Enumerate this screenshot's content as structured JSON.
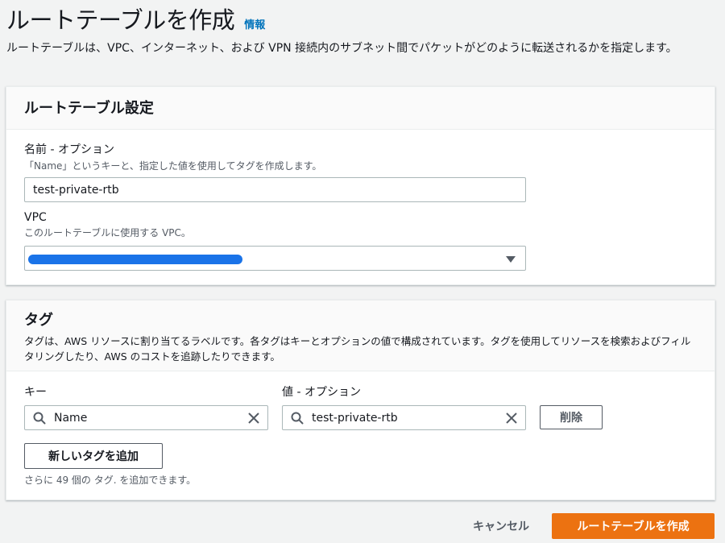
{
  "header": {
    "title": "ルートテーブルを作成",
    "info_link": "情報",
    "description": "ルートテーブルは、VPC、インターネット、および VPN 接続内のサブネット間でパケットがどのように転送されるかを指定します。"
  },
  "settings": {
    "title": "ルートテーブル設定",
    "name": {
      "label": "名前 - オプション",
      "description": "「Name」というキーと、指定した値を使用してタグを作成します。",
      "value": "test-private-rtb"
    },
    "vpc": {
      "label": "VPC",
      "description": "このルートテーブルに使用する VPC。"
    }
  },
  "tags": {
    "title": "タグ",
    "description": "タグは、AWS リソースに割り当てるラベルです。各タグはキーとオプションの値で構成されています。タグを使用してリソースを検索およびフィルタリングしたり、AWS のコストを追跡したりできます。",
    "key_label": "キー",
    "value_label": "値 - オプション",
    "key_value": "Name",
    "value_value": "test-private-rtb",
    "remove_button": "削除",
    "add_button": "新しいタグを追加",
    "hint": "さらに 49 個の タグ. を追加できます。"
  },
  "footer": {
    "cancel": "キャンセル",
    "create": "ルートテーブルを作成"
  },
  "colors": {
    "primary": "#ec7211",
    "link": "#0073bb",
    "background": "#f2f3f3"
  },
  "icons": {
    "search": "search-icon",
    "clear": "close-icon",
    "dropdown": "caret-down-icon"
  }
}
